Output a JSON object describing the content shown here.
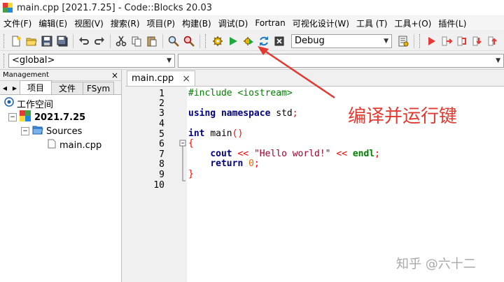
{
  "window": {
    "title": "main.cpp [2021.7.25] - Code::Blocks 20.03"
  },
  "menu": [
    {
      "label": "文件(F)"
    },
    {
      "label": "编辑(E)"
    },
    {
      "label": "视图(V)"
    },
    {
      "label": "搜索(R)"
    },
    {
      "label": "项目(P)"
    },
    {
      "label": "构建(B)"
    },
    {
      "label": "调试(D)"
    },
    {
      "label": "Fortran"
    },
    {
      "label": "可视化设计(W)"
    },
    {
      "label": "工具 (T)"
    },
    {
      "label": "工具+(O)"
    },
    {
      "label": "插件(L)"
    }
  ],
  "toolbar": {
    "build_target": "Debug",
    "icons": [
      "new-file-icon",
      "open-icon",
      "save-icon",
      "save-all-icon",
      "undo-icon",
      "redo-icon",
      "cut-icon",
      "copy-icon",
      "paste-icon",
      "find-icon",
      "replace-icon",
      "build-icon",
      "run-icon",
      "build-run-icon",
      "rebuild-icon",
      "abort-icon"
    ]
  },
  "toolbar2": {
    "scope": "<global>"
  },
  "management": {
    "title": "Management",
    "close": "×",
    "tabs": [
      {
        "label": "项目"
      },
      {
        "label": "文件"
      },
      {
        "label": "FSym"
      }
    ],
    "tree": {
      "workspace": "工作空间",
      "project": "2021.7.25",
      "folder": "Sources",
      "file": "main.cpp"
    }
  },
  "editor": {
    "tab_label": "main.cpp",
    "tab_close": "×",
    "line_numbers": [
      "1",
      "2",
      "3",
      "4",
      "5",
      "6",
      "7",
      "8",
      "9",
      "10"
    ]
  },
  "annotation": {
    "text": "编译并运行键",
    "color": "#e23a30"
  },
  "watermark": {
    "text": "知乎 @六十二"
  }
}
